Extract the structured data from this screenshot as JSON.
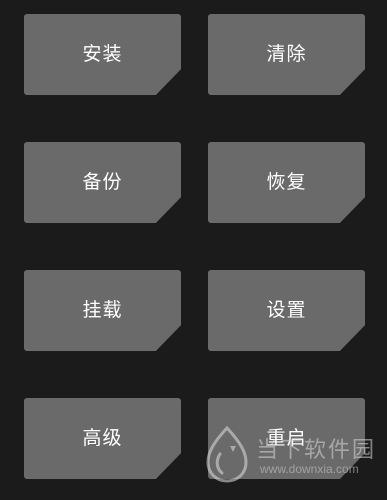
{
  "buttons": {
    "install": "安装",
    "wipe": "清除",
    "backup": "备份",
    "restore": "恢复",
    "mount": "挂载",
    "settings": "设置",
    "advanced": "高级",
    "reboot": "重启"
  },
  "watermark": {
    "name": "当下软件园",
    "url": "www.downxia.com",
    "icon": "downxia-logo-icon"
  },
  "colors": {
    "background": "#1b1b1b",
    "tile": "#6a6a6a",
    "text": "#ffffff"
  }
}
